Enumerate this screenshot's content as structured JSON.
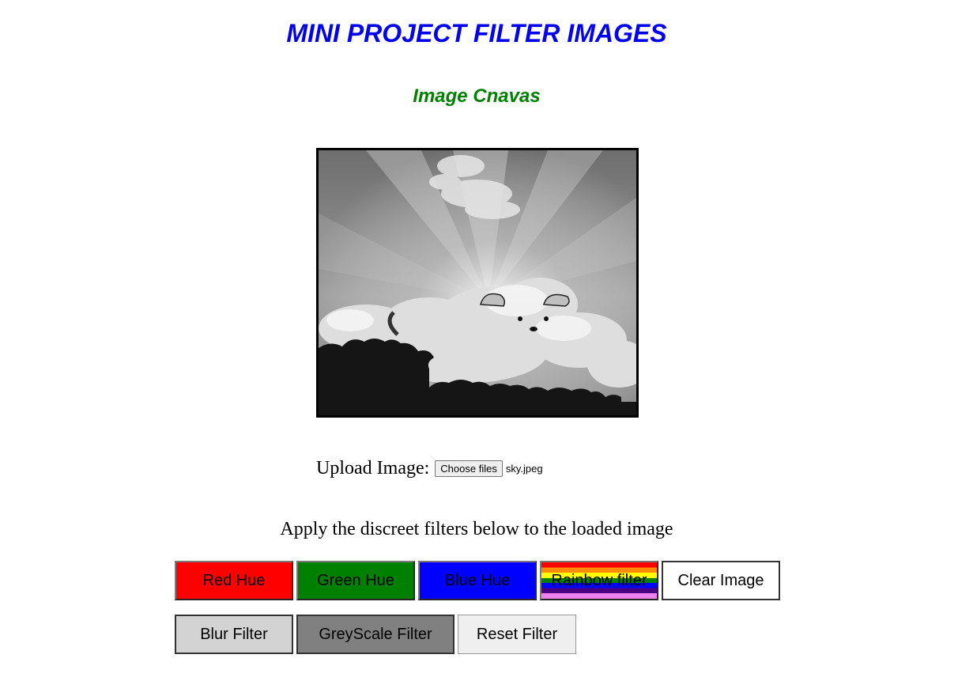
{
  "header": {
    "title": "MINI PROJECT FILTER IMAGES",
    "subtitle": "Image Cnavas"
  },
  "upload": {
    "label": "Upload Image:",
    "button_label": "Choose files",
    "file_name": "sky.jpeg"
  },
  "instructions": "Apply the discreet filters below to the loaded image",
  "filters": {
    "row1": {
      "red": "Red Hue",
      "green": "Green Hue",
      "blue": "Blue Hue",
      "rainbow": "Rainbow filter",
      "clear": "Clear Image"
    },
    "row2": {
      "blur": "Blur Filter",
      "greyscale": "GreyScale Filter",
      "reset": "Reset Filter"
    }
  },
  "colors": {
    "title": "#0000ee",
    "subtitle": "#008000",
    "red_button": "#ff0000",
    "green_button": "#008000",
    "blue_button": "#0000ff",
    "blur_button": "#d3d3d3",
    "greyscale_button": "#808080"
  },
  "image": {
    "description": "greyscale sky with clouds and sun rays"
  }
}
